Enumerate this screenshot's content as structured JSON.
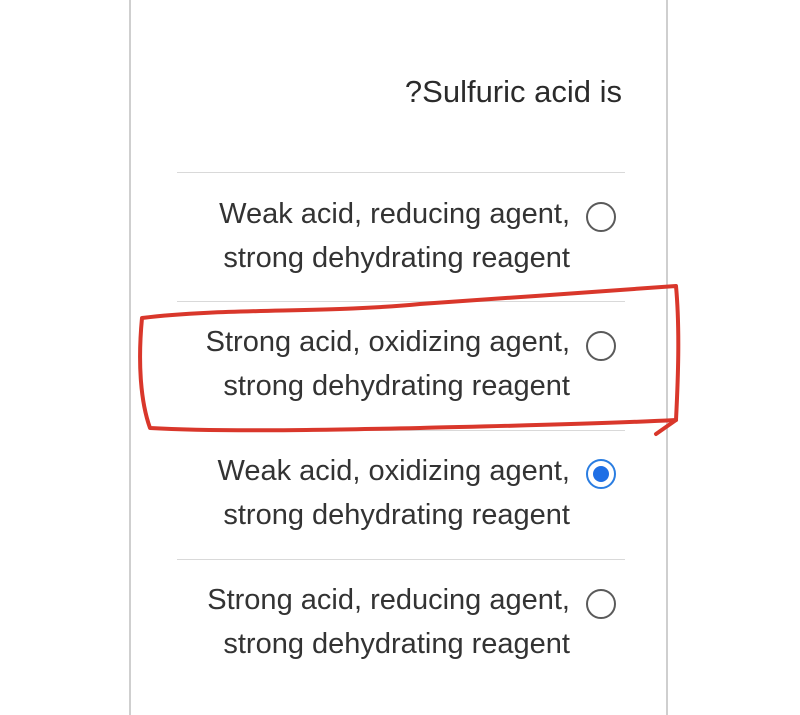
{
  "question": {
    "text": "?Sulfuric acid is"
  },
  "options": [
    {
      "line1": "Weak acid, reducing agent,",
      "line2": "strong dehydrating reagent",
      "selected": false,
      "highlighted": false
    },
    {
      "line1": "Strong acid, oxidizing agent,",
      "line2": "strong dehydrating reagent",
      "selected": false,
      "highlighted": true
    },
    {
      "line1": "Weak acid, oxidizing agent,",
      "line2": "strong dehydrating reagent",
      "selected": true,
      "highlighted": false
    },
    {
      "line1": "Strong acid, reducing agent,",
      "line2": "strong dehydrating reagent",
      "selected": false,
      "highlighted": false
    }
  ],
  "colors": {
    "radio_selected": "#1f6fe5",
    "annotation": "#d9372b",
    "text": "#333333",
    "divider": "#d9d9d9"
  },
  "icons": {
    "radio": "radio-button-icon",
    "annotation": "hand-drawn-highlight-box"
  }
}
